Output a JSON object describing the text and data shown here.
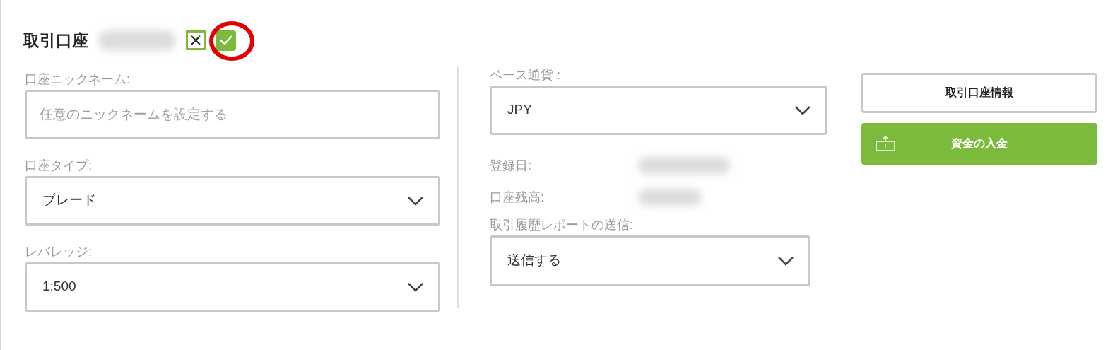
{
  "header": {
    "title": "取引口座",
    "actions": [
      {
        "kind": "cancel"
      },
      {
        "kind": "confirm"
      }
    ],
    "annotation": {
      "kind": "circle"
    }
  },
  "left_fields": [
    {
      "kind": "text",
      "label": "口座ニックネーム:",
      "placeholder": "任意のニックネームを設定する"
    },
    {
      "kind": "select",
      "label": "口座タイプ:",
      "value": "ブレード"
    },
    {
      "kind": "select",
      "label": "レバレッジ:",
      "value": "1:500"
    }
  ],
  "middle": {
    "base_currency": {
      "kind": "select",
      "label": "ベース通貨 :",
      "value": "JPY"
    },
    "info": [
      {
        "label": "登録日:"
      },
      {
        "label": "口座残高:"
      }
    ],
    "report": {
      "kind": "select",
      "label": "取引履歴レポートの送信:",
      "value": "送信する"
    }
  },
  "buttons": [
    {
      "kind": "outline",
      "label": "取引口座情報"
    },
    {
      "kind": "deposit",
      "label": "資金の入金"
    }
  ]
}
